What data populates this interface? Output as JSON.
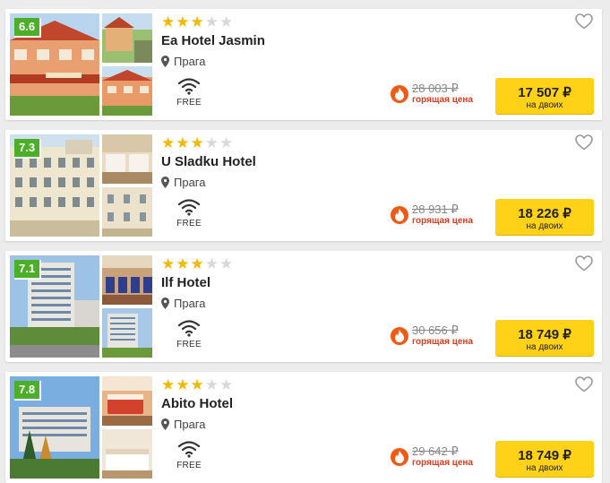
{
  "hotels": [
    {
      "rating": "6.6",
      "stars": "★★★",
      "stars_empty": "★★",
      "name": "Ea Hotel Jasmin",
      "city": "Прага",
      "wifi_label": "FREE",
      "old_price": "28 003 ₽",
      "hot_label": "горящая цена",
      "price": "17 507 ₽",
      "per_label": "на двоих"
    },
    {
      "rating": "7.3",
      "stars": "★★★",
      "stars_empty": "★★",
      "name": "U Sladku Hotel",
      "city": "Прага",
      "wifi_label": "FREE",
      "old_price": "28 931 ₽",
      "hot_label": "горящая цена",
      "price": "18 226 ₽",
      "per_label": "на двоих"
    },
    {
      "rating": "7.1",
      "stars": "★★★",
      "stars_empty": "★★",
      "name": "Ilf Hotel",
      "city": "Прага",
      "wifi_label": "FREE",
      "old_price": "30 656 ₽",
      "hot_label": "горящая цена",
      "price": "18 749 ₽",
      "per_label": "на двоих"
    },
    {
      "rating": "7.8",
      "stars": "★★★",
      "stars_empty": "★★",
      "name": "Abito Hotel",
      "city": "Прага",
      "wifi_label": "FREE",
      "old_price": "29 642 ₽",
      "hot_label": "горящая цена",
      "price": "18 749 ₽",
      "per_label": "на двоих"
    }
  ],
  "colors": {
    "rating_badge": "#4caf28",
    "star": "#f5b800",
    "price_button": "#ffd117",
    "hot": "#e0391a"
  },
  "icons": [
    "map-pin-icon",
    "wifi-icon",
    "heart-icon",
    "flame-icon"
  ]
}
